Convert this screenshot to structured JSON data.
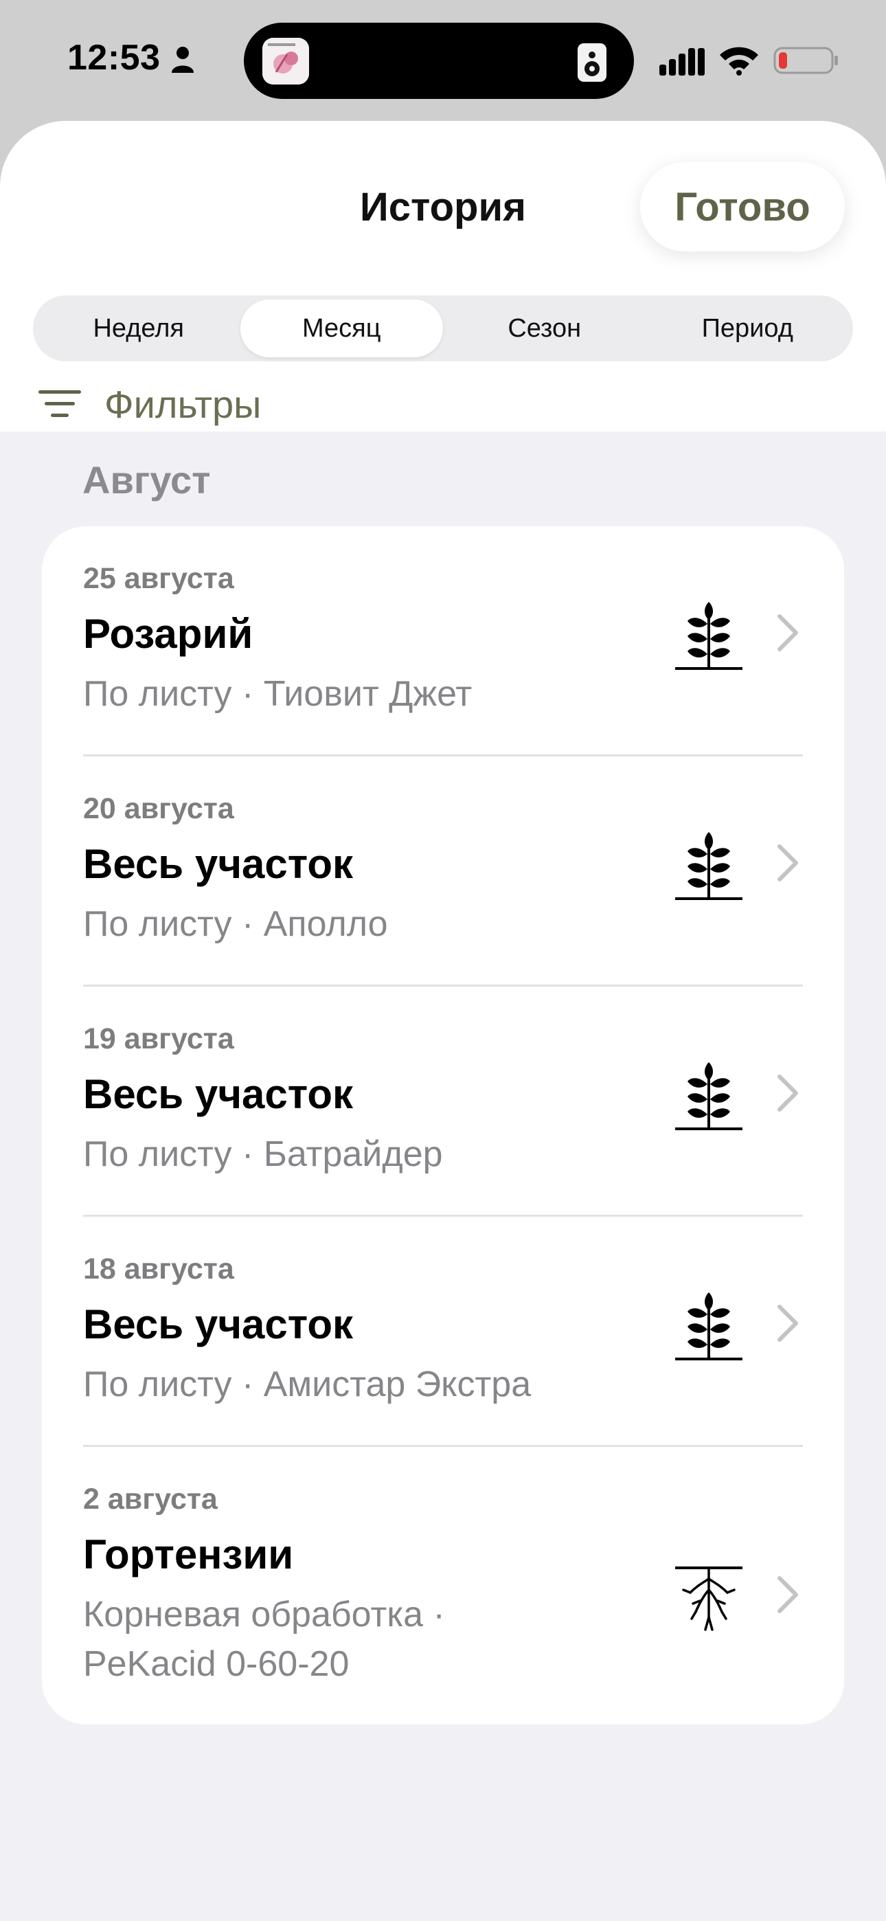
{
  "status_bar": {
    "time": "12:53"
  },
  "header": {
    "title": "История",
    "done_label": "Готово"
  },
  "segments": [
    {
      "label": "Неделя",
      "active": false
    },
    {
      "label": "Месяц",
      "active": true
    },
    {
      "label": "Сезон",
      "active": false
    },
    {
      "label": "Период",
      "active": false
    }
  ],
  "filters": {
    "label": "Фильтры"
  },
  "section": {
    "title": "Август"
  },
  "entries": [
    {
      "date": "25 августа",
      "place": "Розарий",
      "details": "По листу · Тиовит Джет",
      "icon": "leaf-spray-icon"
    },
    {
      "date": "20 августа",
      "place": "Весь участок",
      "details": "По листу · Аполло",
      "icon": "leaf-spray-icon"
    },
    {
      "date": "19 августа",
      "place": "Весь участок",
      "details": "По листу · Батрайдер",
      "icon": "leaf-spray-icon"
    },
    {
      "date": "18 августа",
      "place": "Весь участок",
      "details": "По листу · Амистар Экстра",
      "icon": "leaf-spray-icon"
    },
    {
      "date": "2 августа",
      "place": "Гортензии",
      "details": "Корневая обработка · PeKacid 0-60-20",
      "icon": "root-treatment-icon"
    }
  ],
  "colors": {
    "accent": "#5f6348",
    "sheet_bg": "#f1f1f5",
    "card_bg": "#ffffff",
    "battery_low": "#e53935"
  }
}
